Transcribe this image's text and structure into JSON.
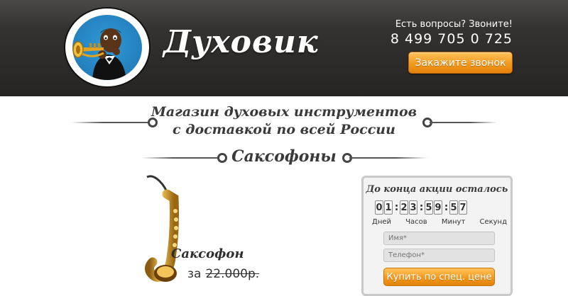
{
  "header": {
    "brand": "Духовик",
    "contact_question": "Есть вопросы? Звоните!",
    "phone": "8 499 705 0 725",
    "callback_label": "Закажите звонок"
  },
  "intro": {
    "line1": "Магазин духовых инструментов",
    "line2": "с доставкой по всей России",
    "category": "Саксофоны"
  },
  "product": {
    "name": "Саксофон",
    "price_prefix": "за",
    "old_price": "22.000р."
  },
  "countdown": {
    "title": "До конца акции осталось",
    "days": [
      "0",
      "1"
    ],
    "hours": [
      "2",
      "3"
    ],
    "minutes": [
      "5",
      "9"
    ],
    "seconds": [
      "5",
      "7"
    ],
    "labels": {
      "days": "Дней",
      "hours": "Часов",
      "minutes": "Минут",
      "seconds": "Секунд"
    },
    "name_placeholder": "Имя*",
    "phone_placeholder": "Телефон*",
    "buy_label": "Купить по спец. цене"
  },
  "colors": {
    "header_bg": "#2e2d2b",
    "button_orange": "#f39a1e",
    "heading_text": "#3a3a3a"
  }
}
